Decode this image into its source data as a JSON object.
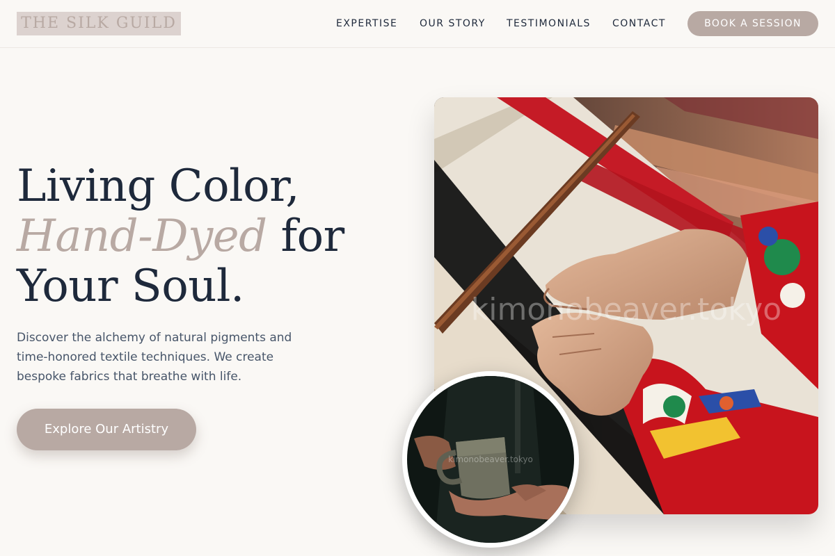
{
  "header": {
    "logo": "THE SILK GUILD",
    "nav": [
      "EXPERTISE",
      "OUR STORY",
      "TESTIMONIALS",
      "CONTACT"
    ],
    "cta": "BOOK A SESSION"
  },
  "hero": {
    "headline_line1": "Living Color,",
    "headline_accent": "Hand-Dyed",
    "headline_line2_rest": " for",
    "headline_line3": "Your Soul.",
    "subtext": "Discover the alchemy of natural pigments and time-honored textile techniques. We create bespoke fabrics that breathe with life.",
    "cta": "Explore Our Artistry"
  },
  "images": {
    "main_watermark": "kimonobeaver.tokyo",
    "circle_watermark": "kimonobeaver.tokyo"
  },
  "colors": {
    "accent": "#b8a9a3",
    "text_dark": "#1e293b",
    "background": "#faf8f5"
  }
}
